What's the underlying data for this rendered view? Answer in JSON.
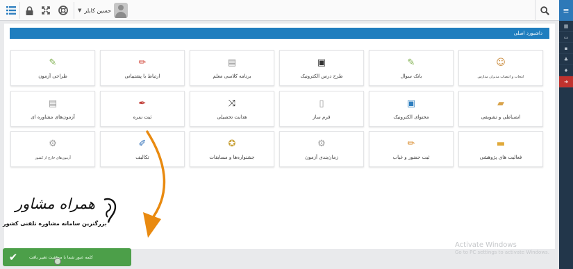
{
  "topbar": {
    "user_name": "حسین کابلر",
    "icons": [
      "menu-icon",
      "lock-icon",
      "fullscreen-icon",
      "support-icon",
      "search-icon"
    ]
  },
  "sidebar": {
    "items": [
      "menu-icon",
      "grid-icon",
      "monitor-icon",
      "lock-icon",
      "users-icon",
      "bulb-icon",
      "logout-icon"
    ],
    "exit_color": "#c0322e"
  },
  "dashboard": {
    "title": "داشبورد اصلی",
    "tiles": [
      {
        "label": "انتخاب و انتصاب مدیران مدارس",
        "icon": "user-icon",
        "color": "#c98a3a",
        "small": true
      },
      {
        "label": "بانک سوال",
        "icon": "question-bank-icon",
        "color": "#7fb04e"
      },
      {
        "label": "طرح درس الکترونیک",
        "icon": "pdf-icon",
        "color": "#333333"
      },
      {
        "label": "برنامه کلاسی معلم",
        "icon": "calendar-icon",
        "color": "#8f8f8f"
      },
      {
        "label": "ارتباط با پشتیبانی",
        "icon": "pencil-red-icon",
        "color": "#d24a3d"
      },
      {
        "label": "طراحی آزمون",
        "icon": "exam-design-icon",
        "color": "#7fb04e"
      },
      {
        "label": "انضباطی و تشویقی",
        "icon": "briefcase-icon",
        "color": "#d8a24a"
      },
      {
        "label": "محتوای الکترونیک",
        "icon": "monitor-content-icon",
        "color": "#2f7fbf"
      },
      {
        "label": "فرم ساز",
        "icon": "form-builder-icon",
        "color": "#9a9a9a"
      },
      {
        "label": "هدایت تحصیلی",
        "icon": "shuffle-icon",
        "color": "#222222"
      },
      {
        "label": "ثبت نمره",
        "icon": "pen-icon",
        "color": "#c2403a"
      },
      {
        "label": "آزمون‌های مشاوره ای",
        "icon": "document-icon",
        "color": "#9a9a9a"
      },
      {
        "label": "فعالیت های پژوهشی",
        "icon": "folder-icon",
        "color": "#e0a93a"
      },
      {
        "label": "ثبت حضور و غیاب",
        "icon": "pencil-orange-icon",
        "color": "#d98b2b"
      },
      {
        "label": "زمان‌بندی آزمون",
        "icon": "schedule-icon",
        "color": "#9a9a9a"
      },
      {
        "label": "جشنواره‌ها و مسابقات",
        "icon": "medal-icon",
        "color": "#c9a23a"
      },
      {
        "label": "تکالیف",
        "icon": "homework-pen-icon",
        "color": "#2f6fb8"
      },
      {
        "label": "آزمون‌های خارج از کشور",
        "icon": "settings-icon",
        "color": "#9a9a9a",
        "small": true
      }
    ]
  },
  "overlay": {
    "logo_title": "همراه مشاور",
    "logo_subtitle": "بزرگترین سامانه مشاوره تلفنی کشور",
    "arrow_color": "#e98a10"
  },
  "toast": {
    "text": "کلمه عبور شما با موفقیت تغییر یافت",
    "color": "#4c9f49"
  },
  "watermark": {
    "title": "Activate Windows",
    "subtitle": "Go to PC settings to activate Windows."
  }
}
